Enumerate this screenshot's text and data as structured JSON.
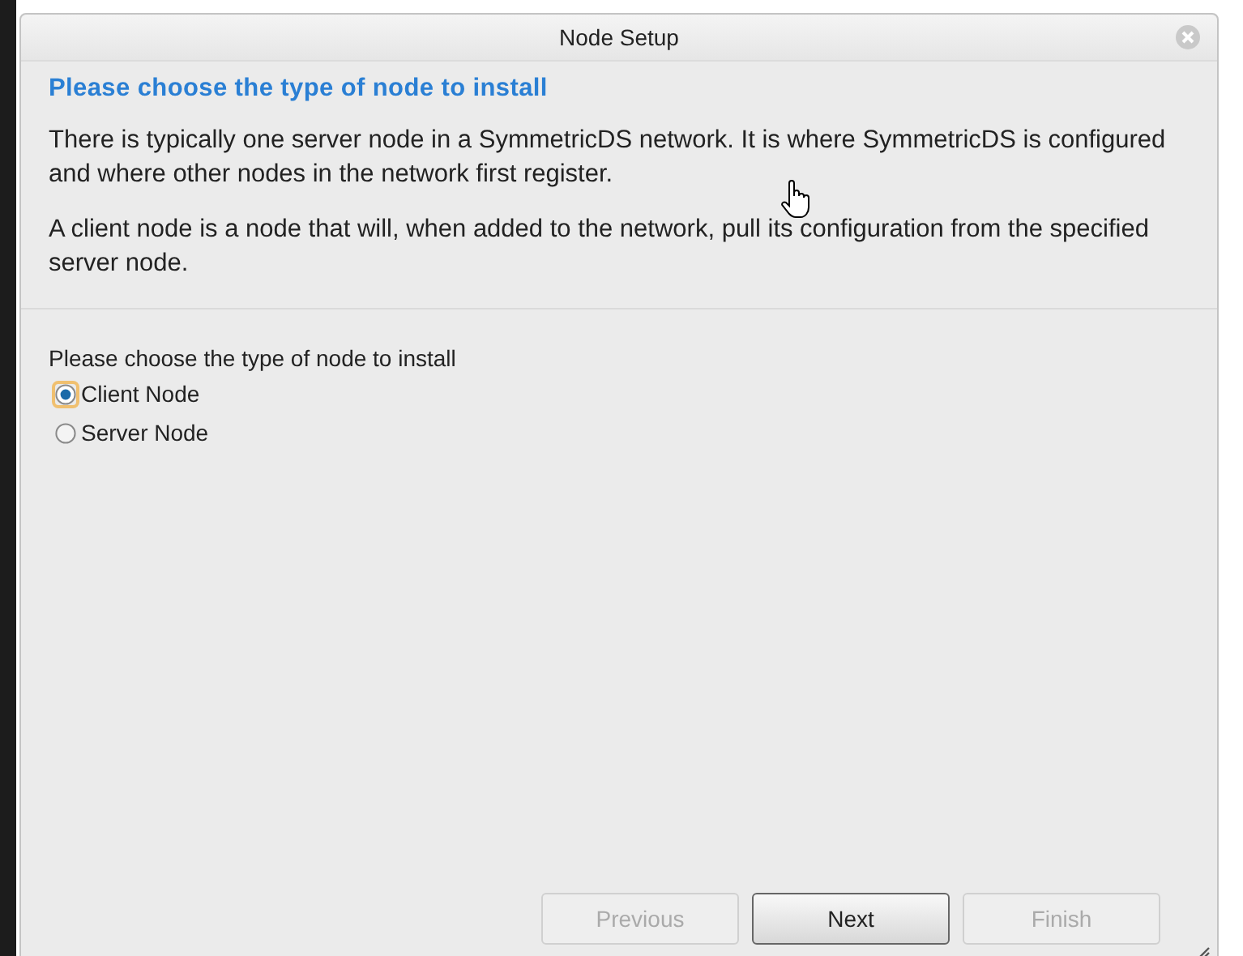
{
  "window": {
    "title": "Node Setup"
  },
  "heading": "Please choose the type of node to install",
  "paragraphs": [
    "There is typically one server node in a SymmetricDS network. It is where SymmetricDS is configured and where other nodes in the network first register.",
    "A client node is a node that will, when added to the network, pull its configuration from the specified server node."
  ],
  "prompt": "Please choose the type of node to install",
  "options": [
    {
      "label": "Client Node",
      "selected": true
    },
    {
      "label": "Server Node",
      "selected": false
    }
  ],
  "buttons": [
    {
      "label": "Previous",
      "disabled": true
    },
    {
      "label": "Next",
      "disabled": false
    },
    {
      "label": "Finish",
      "disabled": true
    }
  ]
}
